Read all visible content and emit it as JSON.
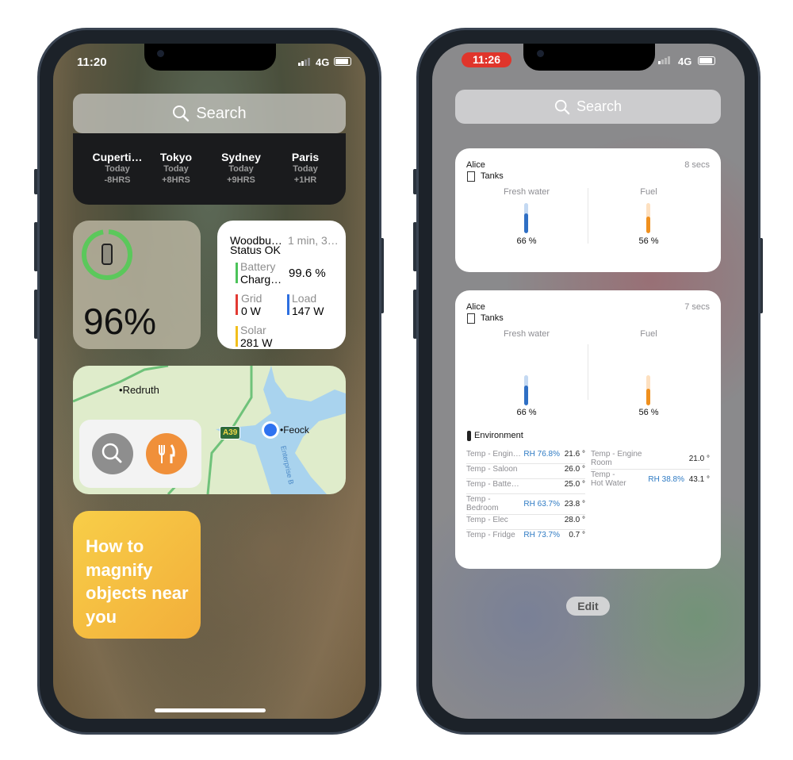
{
  "left_phone": {
    "status": {
      "time": "11:20",
      "network": "4G"
    },
    "search": {
      "placeholder": "Search",
      "icon": "search-icon"
    },
    "world_clock": {
      "cities": [
        {
          "name": "Cuperti…",
          "day": "Today",
          "offset": "-8HRS"
        },
        {
          "name": "Tokyo",
          "day": "Today",
          "offset": "+8HRS"
        },
        {
          "name": "Sydney",
          "day": "Today",
          "offset": "+9HRS"
        },
        {
          "name": "Paris",
          "day": "Today",
          "offset": "+1HR"
        }
      ]
    },
    "battery_widget": {
      "percent_label": "96%",
      "level": 0.96,
      "ring_color": "#5bc85b",
      "icon": "iphone-icon"
    },
    "victron_widget": {
      "site": "Woodbu…",
      "status": "Status OK",
      "updated": "1 min, 3…",
      "battery": {
        "label": "Battery",
        "state": "Charg…",
        "value": "99.6 %",
        "color": "#4cc35a"
      },
      "grid": {
        "label": "Grid",
        "value": "0 W",
        "color": "#e23a33"
      },
      "load": {
        "label": "Load",
        "value": "147 W",
        "color": "#2d6fe0"
      },
      "solar": {
        "label": "Solar",
        "value": "281 W",
        "color": "#f2bf1c"
      }
    },
    "maps_widget": {
      "places": [
        "Redruth",
        "Feock"
      ],
      "road": "A39",
      "water": "Enterprise B",
      "buttons": [
        {
          "icon": "search-icon"
        },
        {
          "icon": "fork-knife-icon",
          "color": "#f0903a"
        }
      ]
    },
    "tips_widget": {
      "text": "How to magnify objects near you"
    }
  },
  "right_phone": {
    "status": {
      "time": "11:26",
      "network": "4G",
      "time_pill_color": "#e0352b"
    },
    "search": {
      "placeholder": "Search",
      "icon": "search-icon"
    },
    "widget_small": {
      "owner": "Alice",
      "age": "8 secs",
      "section": "Tanks",
      "tanks": [
        {
          "name": "Fresh water",
          "level": 0.66,
          "label": "66 %",
          "color": "#2f6fc4"
        },
        {
          "name": "Fuel",
          "level": 0.56,
          "label": "56 %",
          "color": "#f0901e"
        }
      ]
    },
    "widget_large": {
      "owner": "Alice",
      "age": "7 secs",
      "section": "Tanks",
      "tanks": [
        {
          "name": "Fresh water",
          "level": 0.66,
          "label": "66 %",
          "color": "#2f6fc4"
        },
        {
          "name": "Fuel",
          "level": 0.56,
          "label": "56 %",
          "color": "#f0901e"
        }
      ],
      "environment_title": "Environment",
      "env_left": [
        {
          "name": "Temp - Engin…",
          "rh": "RH 76.8%",
          "temp": "21.6 °"
        },
        {
          "name": "Temp - Saloon",
          "rh": "",
          "temp": "26.0 °"
        },
        {
          "name": "Temp - Batte…",
          "rh": "",
          "temp": "25.0 °"
        },
        {
          "name": "Temp -",
          "name2": "Bedroom",
          "rh": "RH 63.7%",
          "temp": "23.8 °"
        },
        {
          "name": "Temp - Elec",
          "rh": "",
          "temp": "28.0 °"
        },
        {
          "name": "Temp - Fridge",
          "rh": "RH 73.7%",
          "temp": "0.7 °"
        }
      ],
      "env_right": [
        {
          "name": "Temp - Engine",
          "name2": "Room",
          "rh": "",
          "temp": "21.0 °"
        },
        {
          "name": "Temp -",
          "name2": "Hot Water",
          "rh": "RH 38.8%",
          "temp": "43.1 °"
        }
      ]
    },
    "edit_label": "Edit"
  }
}
